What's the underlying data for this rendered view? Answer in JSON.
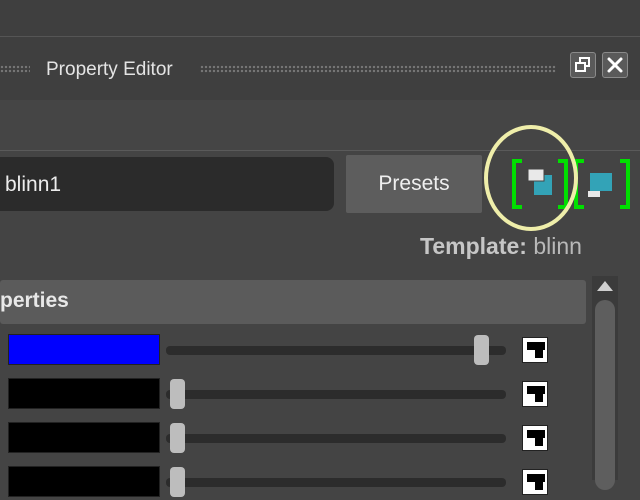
{
  "window": {
    "title": "Property Editor",
    "restore_icon": "restore-window-icon",
    "close_icon": "close-icon"
  },
  "node": {
    "name": "blinn1",
    "presets_label": "Presets",
    "focus_icon": "focus-input-node-icon",
    "show_icon": "show-output-node-icon",
    "template_label": "Template:",
    "template_value": "blinn"
  },
  "section": {
    "label": "perties"
  },
  "rows": [
    {
      "color": "#0000ff",
      "slider": 0.97
    },
    {
      "color": "#000000",
      "slider": 0.0
    },
    {
      "color": "#000000",
      "slider": 0.0
    },
    {
      "color": "#000000",
      "slider": 0.0
    }
  ],
  "colors": {
    "accent_bracket": "#00e000",
    "highlight_ring": "#efeeaa",
    "icon_cyan": "#33a3b7"
  },
  "icons": {
    "map_button": "checker-map-icon",
    "scroll_up": "scroll-up-arrow-icon"
  }
}
